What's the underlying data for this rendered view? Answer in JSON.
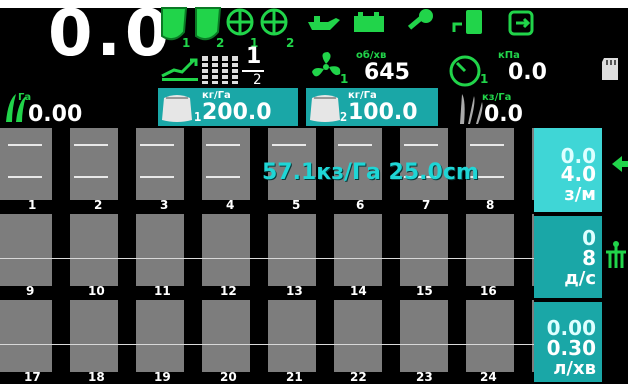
{
  "speed": "0.0",
  "header": {
    "section_subs": [
      "1",
      "2",
      "1",
      "2"
    ],
    "tramline_count": "1",
    "tramline_total": "2",
    "fan": {
      "sub": "1",
      "unit": "об/хв",
      "value": "645"
    },
    "pressure": {
      "sub": "1",
      "unit": "кПа",
      "value": "0.0"
    }
  },
  "area": {
    "unit": "Га",
    "value": "0.00"
  },
  "tanks": [
    {
      "sub": "1",
      "unit": "кг/Га",
      "value": "200.0"
    },
    {
      "sub": "2",
      "unit": "кг/Га",
      "value": "100.0"
    }
  ],
  "seed_rate": {
    "unit": "кз/Га",
    "value": "0.0"
  },
  "overlay_rate": "57.1кз/Га 25.0cm",
  "rows": [
    {
      "labels": [
        "1",
        "2",
        "3",
        "4",
        "5",
        "6",
        "7",
        "8"
      ]
    },
    {
      "labels": [
        "9",
        "10",
        "11",
        "12",
        "13",
        "14",
        "15",
        "16"
      ]
    },
    {
      "labels": [
        "17",
        "18",
        "19",
        "20",
        "21",
        "22",
        "23",
        "24"
      ]
    }
  ],
  "side": [
    {
      "v1": "0.0",
      "v2": "4.0",
      "unit": "з/м"
    },
    {
      "v1": "0",
      "v2": "8",
      "unit": "д/с"
    },
    {
      "v1": "0.00",
      "v2": "0.30",
      "unit": "л/хв"
    }
  ],
  "colors": {
    "accent": "#21d44a",
    "teal": "#1aa7a7",
    "cyan": "#1fd6d6",
    "panel": "#7d7d7d"
  },
  "icons": [
    "hopper-1-icon",
    "hopper-2-icon",
    "fan-1-icon",
    "fan-2-icon",
    "oil-can-icon",
    "battery-icon",
    "key-icon",
    "fuel-icon",
    "export-icon",
    "sd-card-icon",
    "arrow-left-icon",
    "tractor-hitch-icon",
    "tramline-icon",
    "wheat-icon"
  ]
}
